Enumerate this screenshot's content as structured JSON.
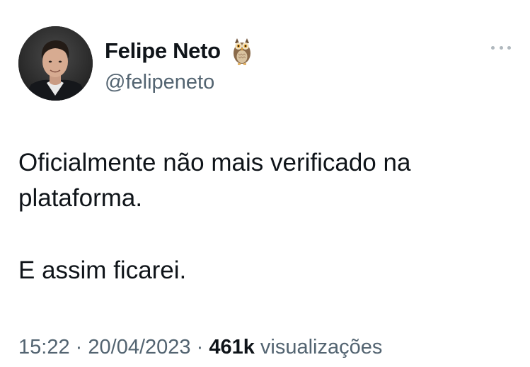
{
  "author": {
    "display_name": "Felipe Neto",
    "handle": "@felipeneto",
    "badge_icon": "owl-icon"
  },
  "tweet": {
    "text_lines": [
      "Oficialmente não mais verificado na",
      "plataforma."
    ],
    "text_second_paragraph": "E assim ficarei."
  },
  "meta": {
    "time": "15:22",
    "separator": "·",
    "date": "20/04/2023",
    "views_count": "461k",
    "views_label": "visualizações"
  },
  "colors": {
    "text_primary": "#0f1419",
    "text_secondary": "#536471",
    "more_dots": "#b0b8be"
  },
  "icons": {
    "more": "more-horizontal-icon"
  }
}
